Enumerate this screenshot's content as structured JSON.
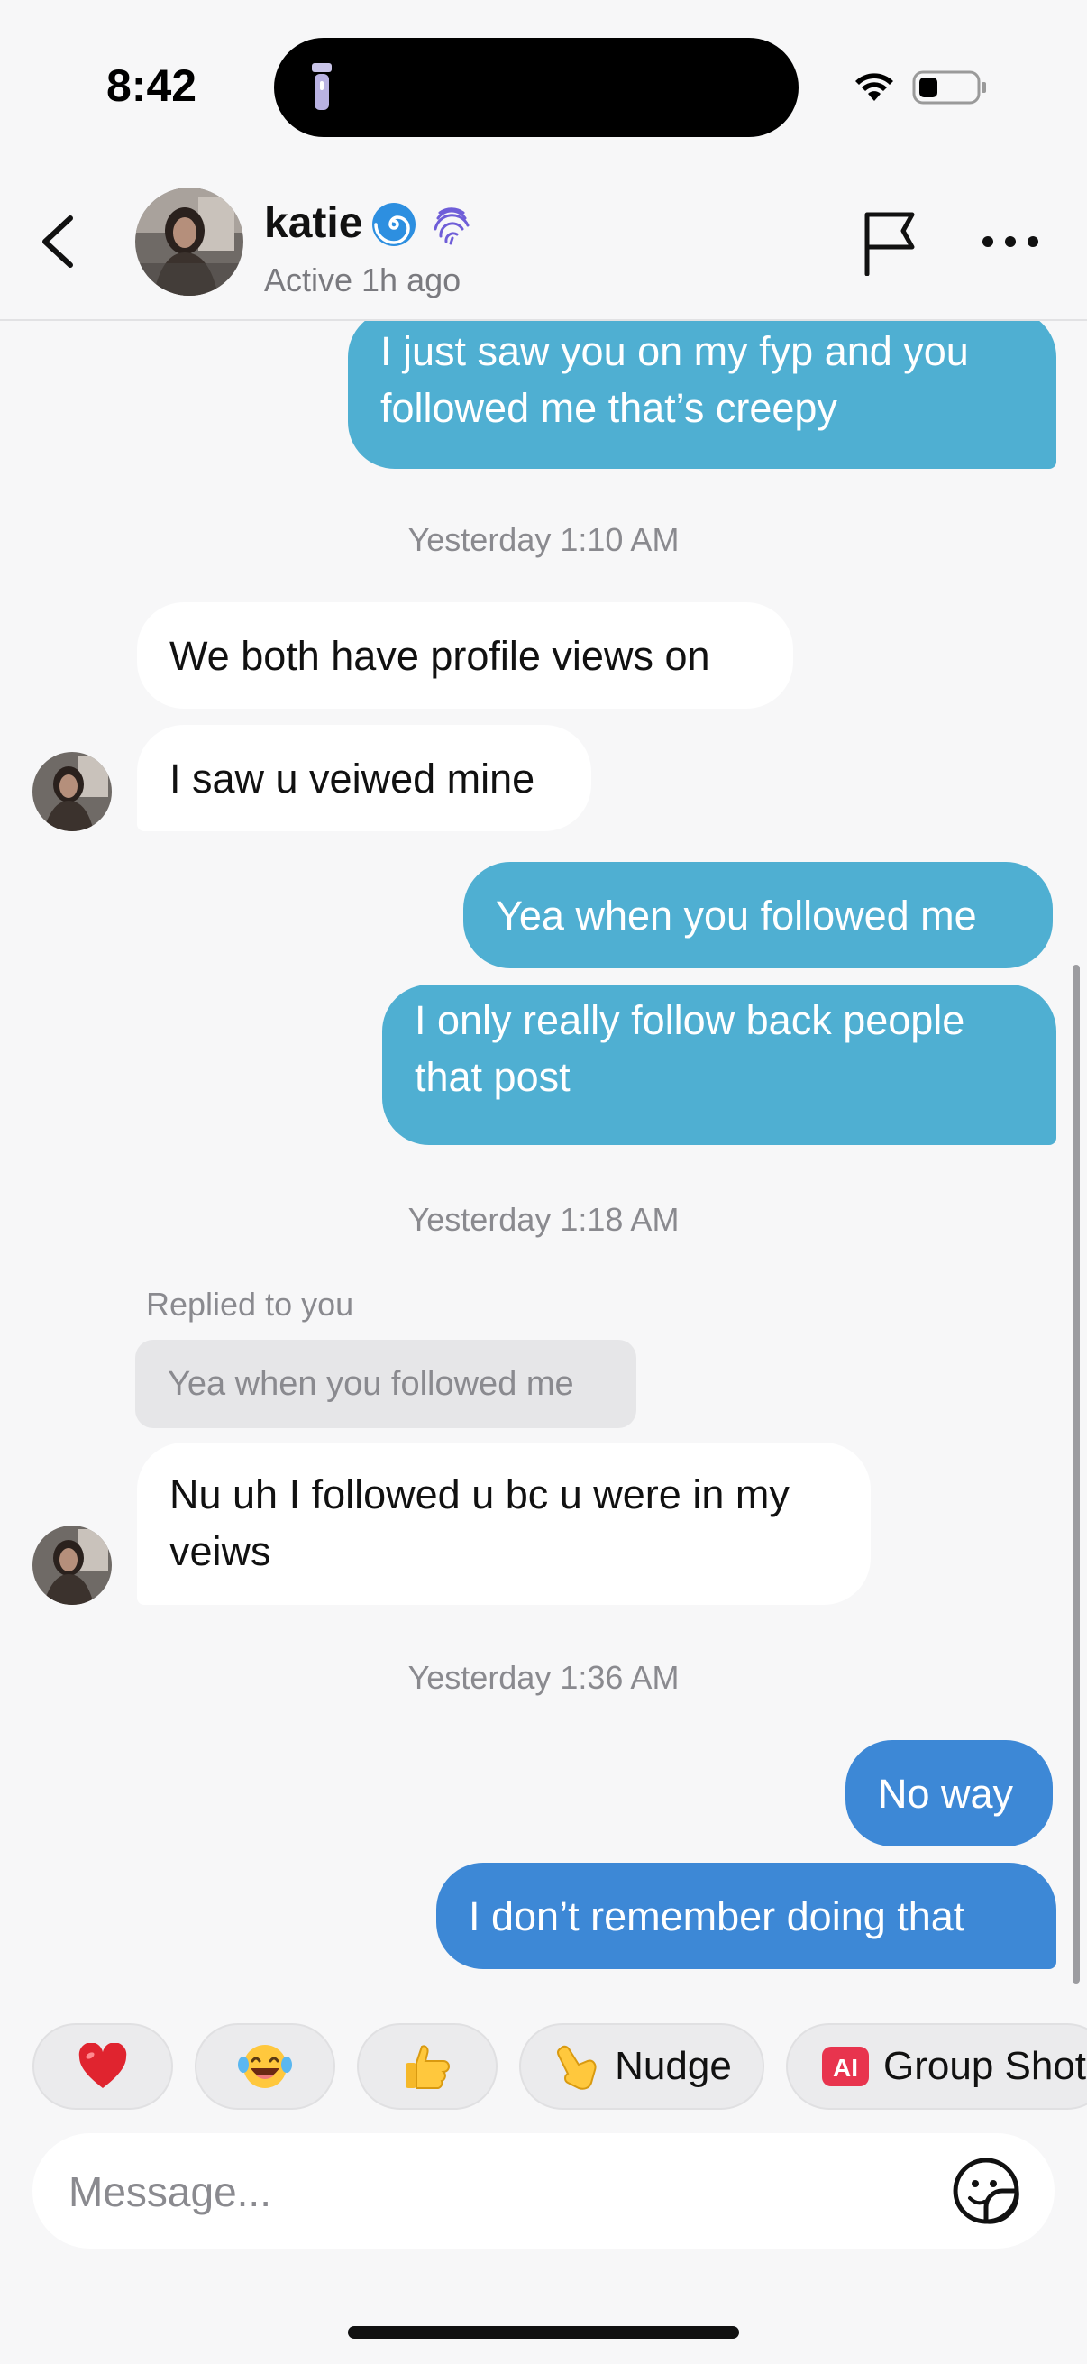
{
  "status_bar": {
    "time": "8:42"
  },
  "header": {
    "contact_name": "katie",
    "name_emojis": [
      "cyclone-emoji",
      "fingerprint-emoji"
    ],
    "status": "Active 1h ago"
  },
  "messages": [
    {
      "direction": "outgoing",
      "text": "I just saw you on my fyp and you followed me that’s creepy"
    },
    {
      "type": "timestamp",
      "text": "Yesterday 1:10 AM"
    },
    {
      "direction": "incoming",
      "text": "We both have profile views on"
    },
    {
      "direction": "incoming",
      "text": "I saw u veiwed mine"
    },
    {
      "direction": "outgoing",
      "text": "Yea when you followed me"
    },
    {
      "direction": "outgoing",
      "text": "I only really follow back people that post"
    },
    {
      "type": "timestamp",
      "text": "Yesterday 1:18 AM"
    },
    {
      "type": "reply_label",
      "text": "Replied to you"
    },
    {
      "type": "reply_quote",
      "text": "Yea when you followed me"
    },
    {
      "direction": "incoming",
      "text": "Nu uh I followed u bc u were in my veiws"
    },
    {
      "type": "timestamp",
      "text": "Yesterday 1:36 AM"
    },
    {
      "direction": "outgoing",
      "text": "No way"
    },
    {
      "direction": "outgoing",
      "text": "I don’t remember doing that"
    }
  ],
  "quick_reactions": [
    {
      "icon": "heart-emoji"
    },
    {
      "icon": "laughing-tears-emoji"
    },
    {
      "icon": "thumbs-up-emoji"
    },
    {
      "icon": "pointing-hand-emoji",
      "label": "Nudge"
    },
    {
      "icon": "ai-badge-icon",
      "badge": "AI",
      "label": "Group Shot"
    }
  ],
  "composer": {
    "placeholder": "Message..."
  },
  "colors": {
    "outgoing_bubble": "#4fafd2",
    "outgoing_bubble_recent": "#3d88d6",
    "incoming_bubble": "#ffffff",
    "background": "#f7f7f8",
    "ai_badge": "#e8344e"
  }
}
